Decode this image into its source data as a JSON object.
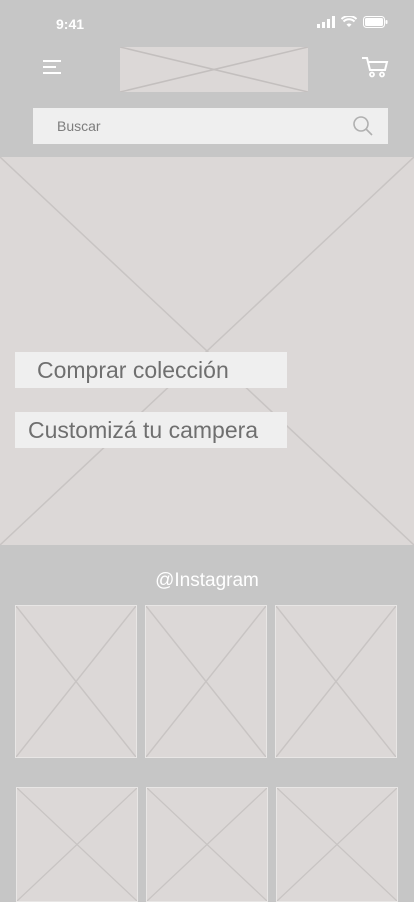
{
  "status_bar": {
    "time": "9:41"
  },
  "header": {
    "menu_icon": "hamburger-icon",
    "cart_icon": "cart-icon"
  },
  "search": {
    "placeholder": "Buscar",
    "icon": "search-icon"
  },
  "hero": {
    "buttons": [
      {
        "label": "Comprar colección"
      },
      {
        "label": "Customizá tu campera"
      }
    ]
  },
  "instagram": {
    "title": "@Instagram",
    "tiles": 6
  },
  "colors": {
    "background": "#c6c6c6",
    "placeholder": "#dcd8d7",
    "surface": "#efefef",
    "text": "#6f6f6f"
  }
}
